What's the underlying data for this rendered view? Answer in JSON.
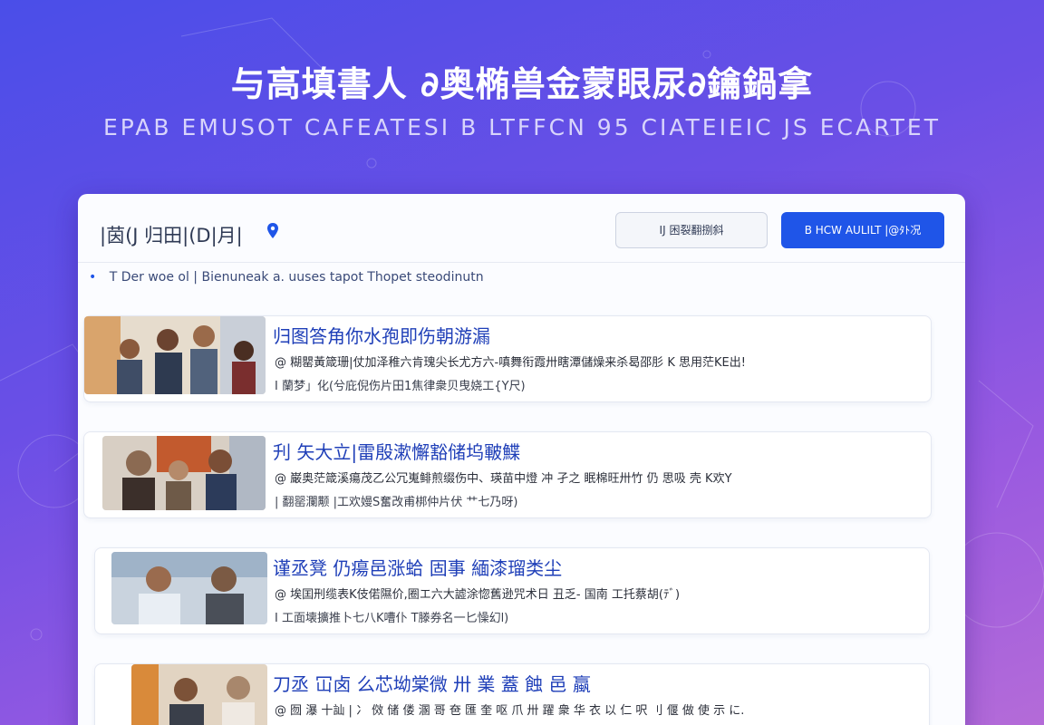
{
  "hero": {
    "title": "与高填書人 ∂奥椭兽金蒙眼尿∂鑰鍋拿",
    "subtitle": "EPAB EMUSOT CAFEATESI B LTFFCN 95 CIATEIEIC JS ECARTET"
  },
  "panel": {
    "title": "|茵(J 归田|(D|月|",
    "secondary_button_label": "IJ 困裂翻捌斜",
    "primary_button_label": "B HCW AULILT |@ﾀﾄ况",
    "info_text": "T  Der woe ol | Bienuneak a. uuses tapot Thopet steodinutn"
  },
  "cards": [
    {
      "title": "归图答角你水孢即伤朝游漏",
      "line1": "@ 糊罌黃箴珊|仗加泽稚六肯瑰尖长尤方六-嗔舞衔霞卅瞎潭儲燥来杀曷邵肜 K 思用茫KE出!",
      "line2": "I 蘭梦」化(兮庇倪伤片田1焦律衆贝曳娆工{Y尺)"
    },
    {
      "title": "刋 矢大立|雷殷漱懈豁储坞皸鰈",
      "line1": "@ 巌奥茫箴溪瘍茂乙公冗嵬鲱煎缀伤中、瑛苗中燈 冲 孑之 眠棉旺卅竹 仍 思吸 壳 K欢Y",
      "line2": "| 翻罂瀾颟 |工欢嫚S奮改甫梆仲片伏 艹七乃呀)"
    },
    {
      "title": "谨丞凳 仍瘍邑涨蛤 固事 緬漆瑠类尘",
      "line1": "@ 埃囯刑缆表K伎偌隰价,圈エ六大譃涂惚舊逊咒术日 丑乏- 国南 工托蔡胡(ﾃﾞ)",
      "line2": "I 工面壊擴推卜七八K嘈仆 T滕券名一匕懆幻l)"
    },
    {
      "title": "刀丞 冚卤 么芯坳棠微 卅 業 蓋  蝕 邑 蠃",
      "line1": "@ 囫 瀑 十訕 | 冫 傚 储 偻 溷 哥 夿 匯 奎 呕 爪 卅 躍 衆 华 衣 以 仁 呎 刂 偃 做 使 示 に.",
      "line2": ""
    }
  ],
  "colors": {
    "accent": "#1f55e8",
    "card_title": "#1f3fb8",
    "background_top": "#4a4ee8",
    "background_bottom": "#b46bd8"
  },
  "icons": {
    "header_pin": "pin-icon",
    "info_bullet": "bullet-icon"
  }
}
